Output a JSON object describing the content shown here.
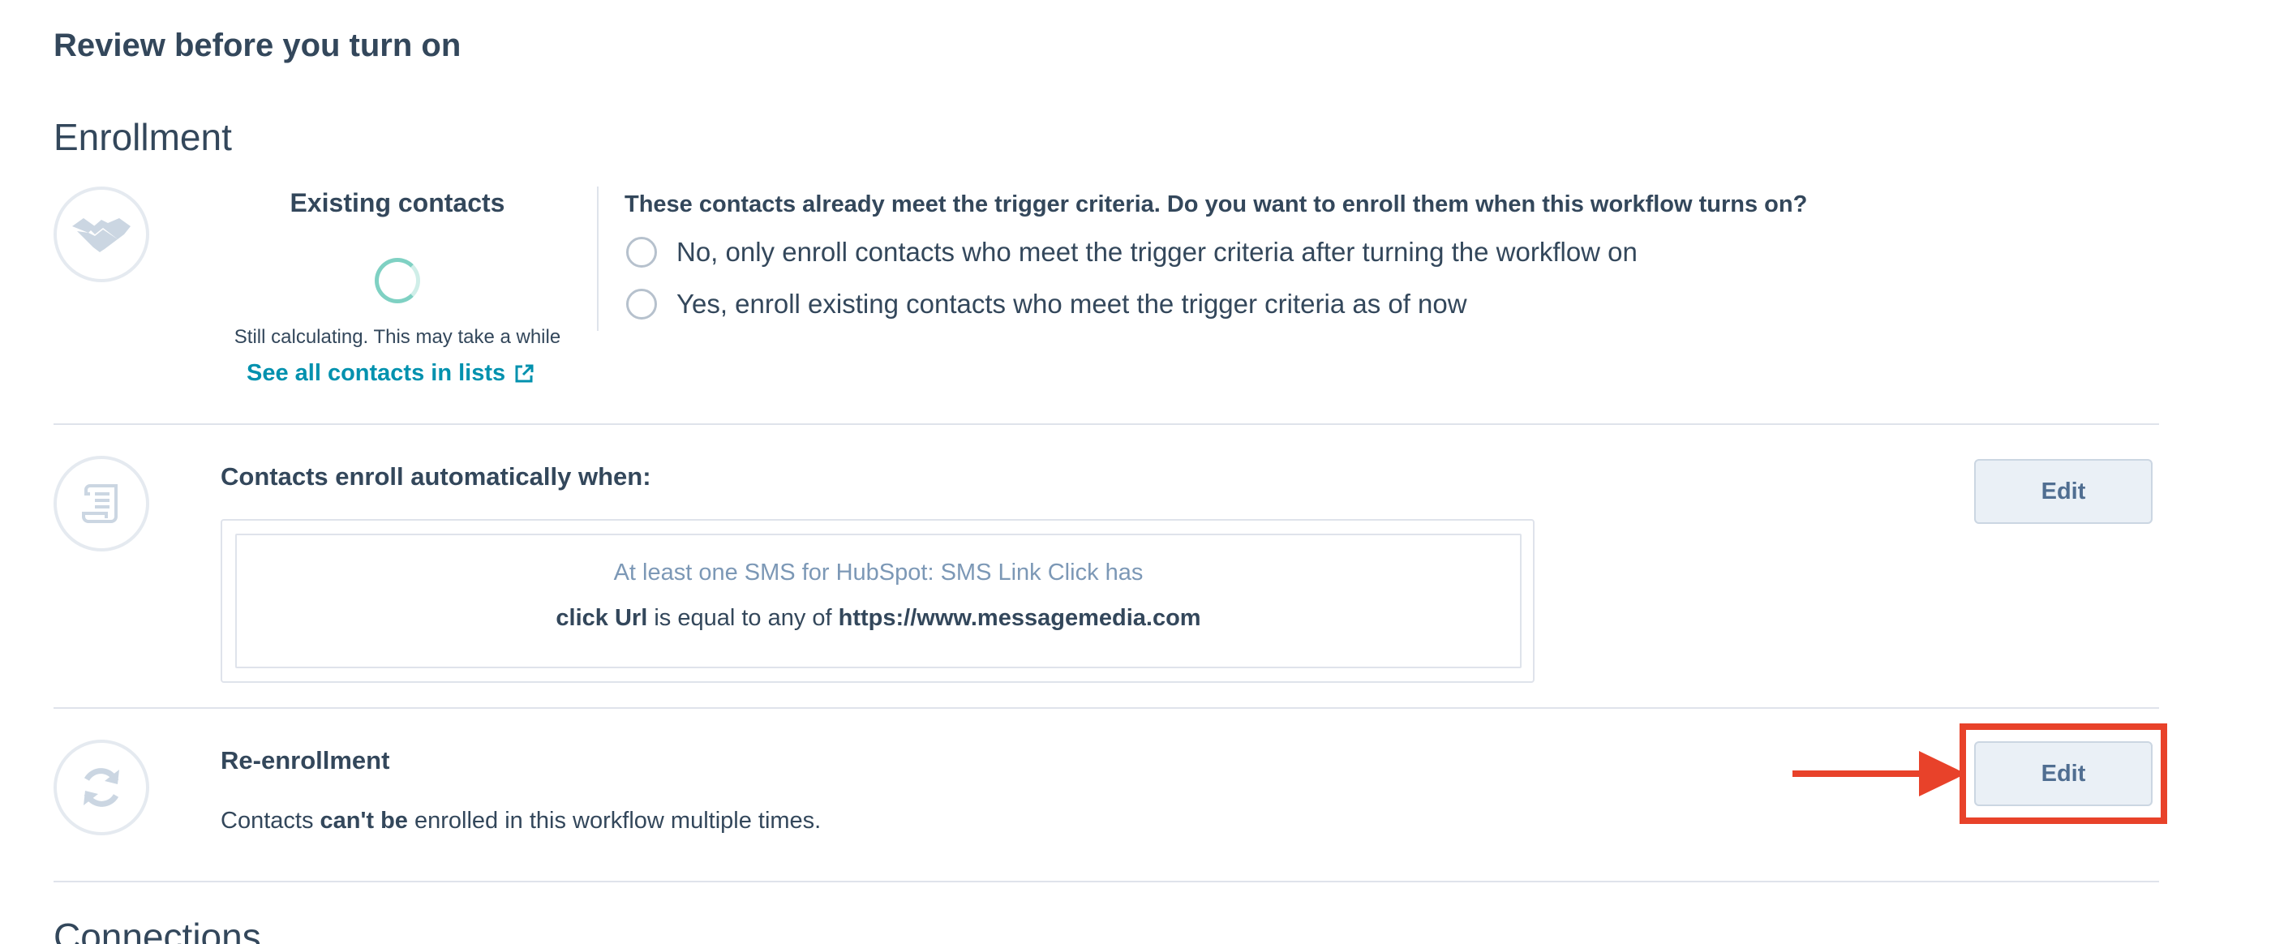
{
  "page": {
    "title": "Review before you turn on"
  },
  "enrollment": {
    "section_title": "Enrollment",
    "existing": {
      "icon": "handshake-icon",
      "title": "Existing contacts",
      "status": "Still calculating. This may take a while",
      "link_label": "See all contacts in lists",
      "link_icon": "external-link-icon",
      "question": "These contacts already meet the trigger criteria. Do you want to enroll them when this workflow turns on?",
      "options": [
        {
          "label": "No, only enroll contacts who meet the trigger criteria after turning the workflow on",
          "selected": false
        },
        {
          "label": "Yes, enroll existing contacts who meet the trigger criteria as of now",
          "selected": false
        }
      ]
    },
    "trigger": {
      "icon": "scroll-icon",
      "title": "Contacts enroll automatically when:",
      "edit_label": "Edit",
      "criteria_header": "At least one SMS for HubSpot: SMS Link Click has",
      "criteria_property": "click Url",
      "criteria_operator": " is equal to any of ",
      "criteria_value": "https://www.messagemedia.com"
    },
    "reenrollment": {
      "icon": "refresh-icon",
      "title": "Re-enrollment",
      "edit_label": "Edit",
      "desc_prefix": "Contacts ",
      "desc_bold": "can't be",
      "desc_suffix": " enrolled in this workflow multiple times."
    }
  },
  "connections": {
    "section_title": "Connections"
  },
  "colors": {
    "text": "#33475b",
    "link": "#0091ae",
    "annotation": "#e8422a",
    "button_bg": "#eaf0f6",
    "divider": "#dfe3eb"
  }
}
